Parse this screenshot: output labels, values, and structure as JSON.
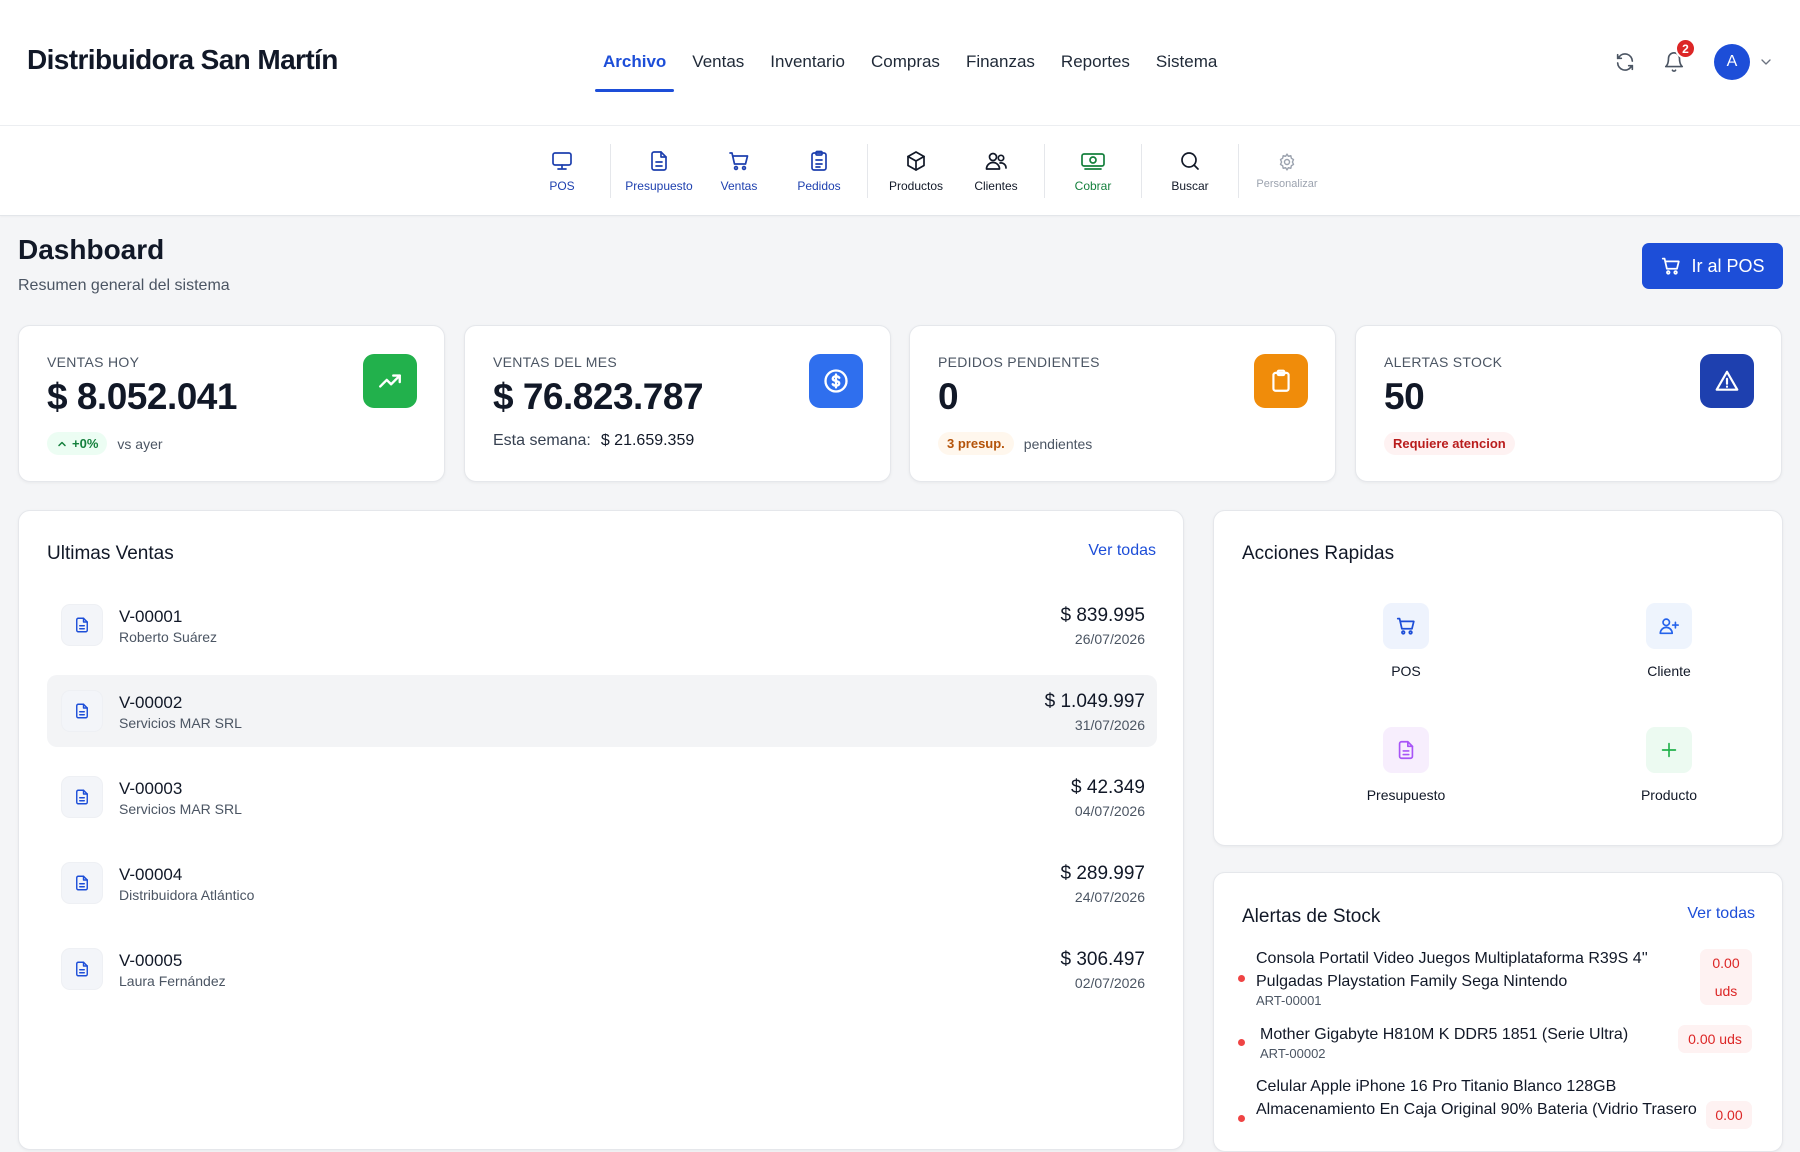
{
  "app": {
    "brand": "Distribuidora San Martín",
    "nav": [
      "Archivo",
      "Ventas",
      "Inventario",
      "Compras",
      "Finanzas",
      "Reportes",
      "Sistema"
    ],
    "active_nav": "Archivo",
    "notifications_count": "2",
    "avatar_letter": "A"
  },
  "toolbar": {
    "pos": "POS",
    "presupuesto": "Presupuesto",
    "ventas": "Ventas",
    "pedidos": "Pedidos",
    "productos": "Productos",
    "clientes": "Clientes",
    "cobrar": "Cobrar",
    "buscar": "Buscar",
    "personalizar": "Personalizar"
  },
  "page": {
    "title": "Dashboard",
    "subtitle": "Resumen general del sistema",
    "go_pos_label": "Ir al POS"
  },
  "stats": {
    "ventas_hoy": {
      "label": "VENTAS HOY",
      "value": "$ 8.052.041",
      "change": "+0%",
      "change_note": "vs ayer"
    },
    "ventas_mes": {
      "label": "VENTAS DEL MES",
      "value": "$ 76.823.787",
      "week_label": "Esta semana:",
      "week_value": "$ 21.659.359"
    },
    "pedidos": {
      "label": "PEDIDOS PENDIENTES",
      "value": "0",
      "badge": "3 presup.",
      "note": "pendientes"
    },
    "alertas": {
      "label": "ALERTAS STOCK",
      "value": "50",
      "badge": "Requiere atencion"
    }
  },
  "ultimas_ventas": {
    "title": "Ultimas Ventas",
    "link": "Ver todas",
    "rows": [
      {
        "num": "V-00001",
        "client": "Roberto Suárez",
        "amount": "$ 839.995",
        "date": "26/07/2026"
      },
      {
        "num": "V-00002",
        "client": "Servicios MAR SRL",
        "amount": "$ 1.049.997",
        "date": "31/07/2026"
      },
      {
        "num": "V-00003",
        "client": "Servicios MAR SRL",
        "amount": "$ 42.349",
        "date": "04/07/2026"
      },
      {
        "num": "V-00004",
        "client": "Distribuidora Atlántico",
        "amount": "$ 289.997",
        "date": "24/07/2026"
      },
      {
        "num": "V-00005",
        "client": "Laura Fernández",
        "amount": "$ 306.497",
        "date": "02/07/2026"
      }
    ]
  },
  "acciones": {
    "title": "Acciones Rapidas",
    "items": [
      "POS",
      "Cliente",
      "Presupuesto",
      "Producto"
    ]
  },
  "alertas_stock": {
    "title": "Alertas de Stock",
    "link": "Ver todas",
    "items": [
      {
        "name_line1": "Consola Portatil Video Juegos Multiplataforma R39S 4''",
        "name_line2": "Pulgadas Playstation Family Sega Nintendo",
        "code": "ART-00001",
        "qty_a": "0.00",
        "qty_b": "uds"
      },
      {
        "name_line1": "Mother Gigabyte H810M K DDR5 1851 (Serie Ultra)",
        "code": "ART-00002",
        "qty": "0.00 uds"
      },
      {
        "name_line1": "Celular Apple iPhone 16 Pro Titanio Blanco 128GB",
        "name_line2": "Almacenamiento En Caja Original 90% Bateria (Vidrio Trasero",
        "qty_a": "0.00"
      }
    ]
  },
  "colors": {
    "primary": "#1d4ed8",
    "green": "#22b14c",
    "blue": "#2f6fee",
    "amber": "#f08c0a",
    "navy": "#1e40af",
    "danger": "#ef4444"
  }
}
